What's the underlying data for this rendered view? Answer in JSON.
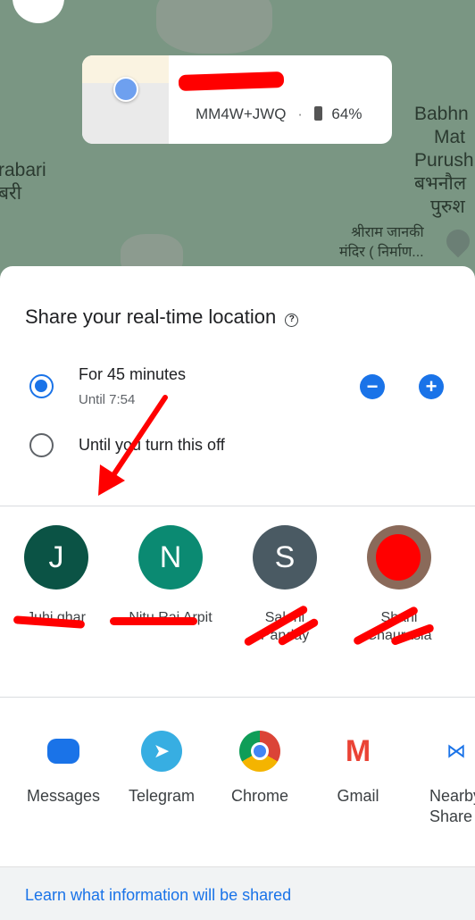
{
  "map": {
    "labels_left": [
      "rabari",
      "बरी"
    ],
    "labels_right": [
      "Babhn",
      "Mat",
      "Purush",
      "बभनौल",
      "पुरुश"
    ],
    "poi": [
      "श्रीराम जानकी",
      "मंदिर ( निर्माण..."
    ],
    "poi_icon": "om-pin-icon"
  },
  "location_card": {
    "plus_code": "MM4W+JWQ",
    "separator": "·",
    "battery_icon": "battery-icon",
    "battery": "64%"
  },
  "sheet": {
    "title": "Share your real-time location",
    "options": [
      {
        "label": "For 45 minutes",
        "sublabel": "Until 7:54",
        "selected": true
      },
      {
        "label": "Until you turn this off",
        "selected": false
      }
    ],
    "duration_minutes": 45,
    "contacts": [
      {
        "initial": "J",
        "name": "Juhi ghar",
        "color": "#0b5345"
      },
      {
        "initial": "N",
        "name": "Nitu Rai Arpit",
        "color": "#0b8a72"
      },
      {
        "initial": "S",
        "name": "Saloni Panday",
        "color": "#4a5a63"
      },
      {
        "initial": "",
        "name": "Shani Chaurasia",
        "color": "#8a6a5a"
      }
    ],
    "apps": [
      {
        "label": "Messages"
      },
      {
        "label": "Telegram"
      },
      {
        "label": "Chrome"
      },
      {
        "label": "Gmail"
      },
      {
        "label": "Nearby Share"
      }
    ],
    "footer_link": "Learn what information will be shared"
  },
  "colors": {
    "accent": "#1a73e8",
    "map": "#7a9683",
    "redaction": "#ff0000"
  }
}
